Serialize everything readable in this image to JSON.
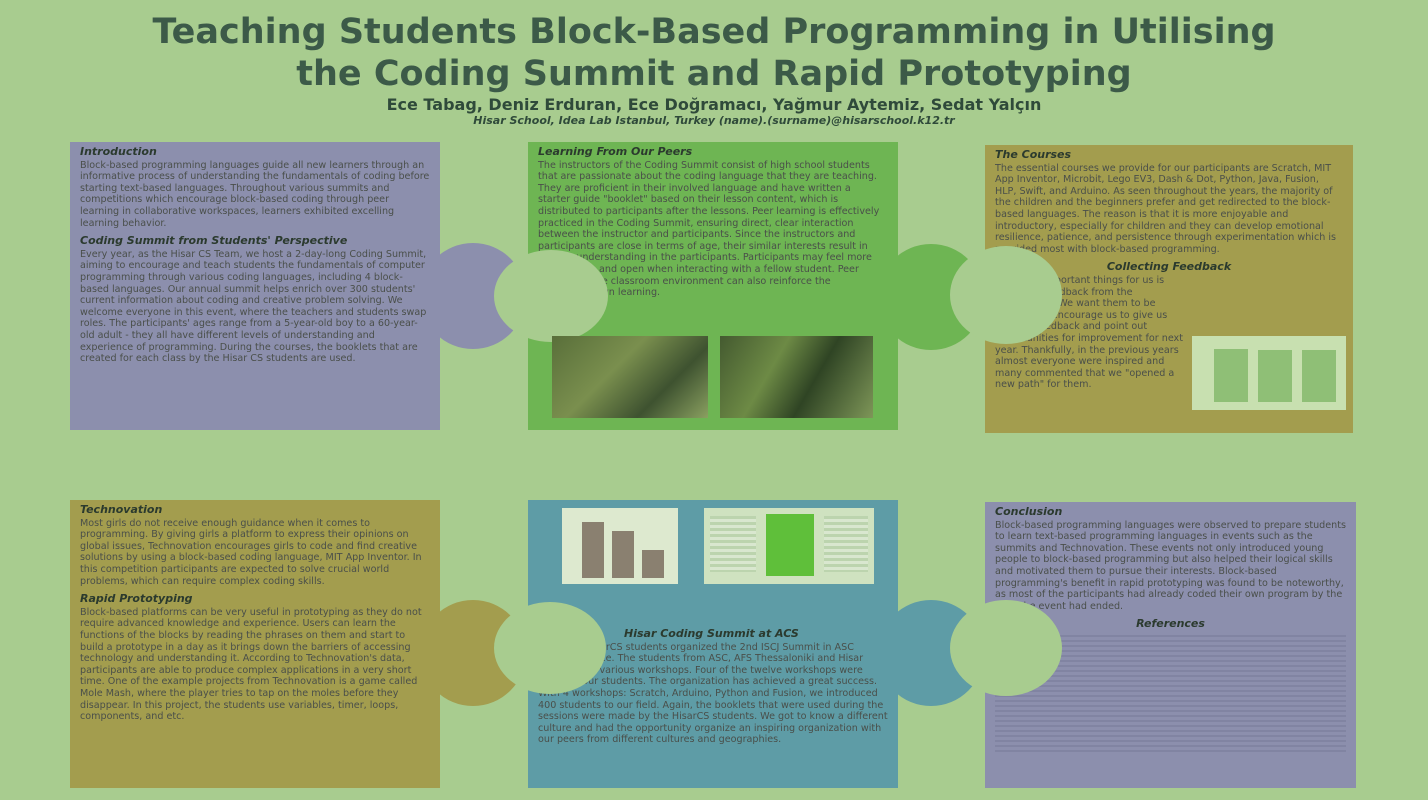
{
  "header": {
    "title_line1": "Teaching Students Block-Based Programming in Utilising",
    "title_line2": "the Coding Summit and Rapid Prototyping",
    "authors": "Ece Tabag, Deniz Erduran, Ece Doğramacı, Yağmur Aytemiz, Sedat Yalçın",
    "affiliation": "Hisar School, Idea Lab Istanbul, Turkey (name).(surname)@hisarschool.k12.tr"
  },
  "intro": {
    "heading": "Introduction",
    "body": "Block-based programming languages guide all new learners through an informative process of understanding the fundamentals of coding before starting text-based languages. Throughout various summits and competitions which encourage block-based coding through peer learning in collaborative workspaces, learners exhibited excelling learning behavior."
  },
  "summit": {
    "heading": "Coding Summit from Students' Perspective",
    "body": "Every year, as the Hisar CS Team, we host a 2-day-long Coding Summit, aiming to encourage and teach students the fundamentals of computer programming through various coding languages, including 4 block-based languages. Our annual summit helps enrich over 300 students' current information about coding and creative problem solving. We welcome everyone in this event, where the teachers and students swap roles. The participants' ages range from a 5-year-old boy to a 60-year-old adult - they all have different levels of understanding and experience of programming. During the courses, the booklets that are created for each class by the Hisar CS students are used."
  },
  "peers": {
    "heading": "Learning From Our Peers",
    "body": "The instructors of the Coding Summit consist of high school students that are passionate about the coding language that they are teaching. They are proficient in their involved language and have written a starter guide \"booklet\" based on their lesson content, which is distributed to participants after the lessons. Peer learning is effectively practiced in the Coding Summit, ensuring direct, clear interaction between the instructor and participants. Since the instructors and participants are close in terms of age, their similar interests result in greater understanding in the participants. Participants may feel more comfortable and open when interacting with a fellow student. Peer learning in the classroom environment can also reinforce the instructors' own learning."
  },
  "courses": {
    "heading": "The Courses",
    "body": "The essential courses we provide for our participants are Scratch, MIT App Inventor, Microbit, Lego EV3, Dash & Dot, Python, Java, Fusion, HLP, Swift, and Arduino. As seen throughout the years, the majority of the children and the beginners prefer and get redirected to the block-based languages. The reason is that it is more enjoyable and introductory, especially for children and they can develop emotional resilience, patience, and persistence through experimentation which is provided most with block-based programming."
  },
  "feedback": {
    "heading": "Collecting Feedback",
    "body": "The most important things for us is collecting feedback from the participants. We want them to be honest and encourage us to give us positive feedback and point out opportunities for improvement for next year. Thankfully, in the previous years almost everyone were inspired and many commented that we \"opened a new path\" for them."
  },
  "technovation": {
    "heading": "Technovation",
    "body": "Most girls do not receive enough guidance when it comes to programming. By giving girls a platform to express their opinions on global issues, Technovation encourages girls to code and find creative solutions by using a block-based coding language, MIT App Inventor. In this competition participants are expected to solve crucial world problems, which can require complex coding skills."
  },
  "rapid": {
    "heading": "Rapid Prototyping",
    "body": "Block-based platforms can be very useful in prototyping as they do not require advanced knowledge and experience. Users can learn the functions of the blocks by reading the phrases on them and start to build a prototype in a day as it brings down the barriers of accessing technology and understanding it. According to Technovation's data, participants are able to produce complex applications in a very short time. One of the example projects from Technovation is a game called Mole Mash, where the player tries to tap on the moles before they disappear. In this project, the students use variables, timer, loops, components, and etc."
  },
  "acs": {
    "heading": "Hisar Coding Summit at ACS",
    "body": "This year HisarCS students organized the 2nd ISCJ Summit in ASC Athens, Greece. The students from ASC, AFS Thessaloniki and Hisar School gave various workshops. Four of the twelve workshops were given by our students. The organization has achieved a great success. With 4 workshops: Scratch, Arduino, Python and Fusion, we introduced 400 students to our field. Again, the booklets that were used during the sessions were made by the HisarCS students. We got to know a different culture and had the opportunity organize an inspiring organization with our peers from different cultures and geographies."
  },
  "conclusion": {
    "heading": "Conclusion",
    "body": "Block-based programming languages were observed to prepare students to learn text-based programming languages in events such as the summits and Technovation. These events not only introduced young people to block-based programming but also helped their logical skills and motivated them to pursue their interests. Block-based programming's benefit in rapid prototyping was found to be noteworthy, as most of the participants had already coded their own program by the time the event had ended."
  },
  "references": {
    "heading": "References"
  },
  "feedback_chart": {
    "bars": [
      0.95,
      0.92,
      0.93
    ]
  },
  "acs_chart": {
    "bars": [
      0.9,
      0.75,
      0.45
    ]
  },
  "colors": {
    "background": "#a8cc8f",
    "title": "#3c5a48",
    "lavender": "#8c8fad",
    "green": "#6eb553",
    "olive": "#a39d4e",
    "teal": "#5e9ca6"
  }
}
